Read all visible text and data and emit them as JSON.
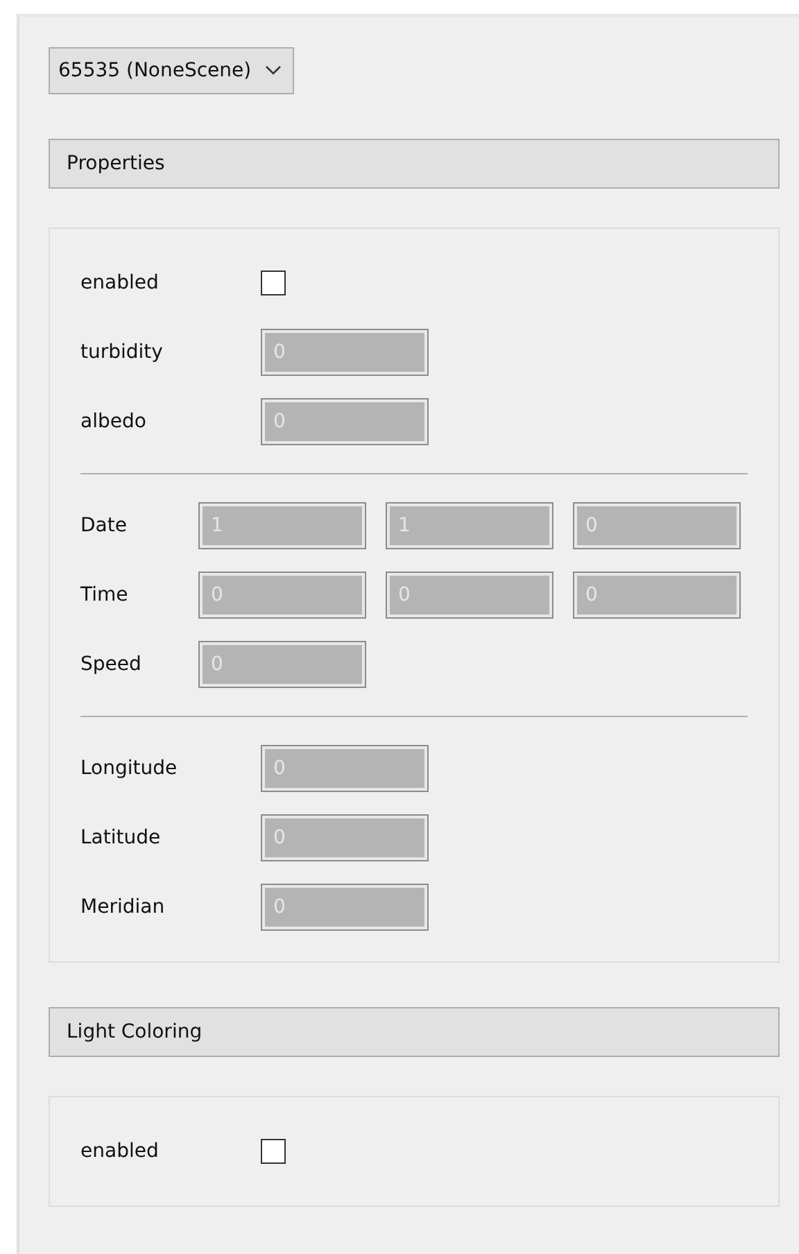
{
  "scene_dropdown": {
    "value": "65535 (NoneScene)"
  },
  "sections": [
    {
      "title": "Properties",
      "rows": [
        {
          "kind": "checkbox",
          "label": "enabled",
          "checked": false
        },
        {
          "kind": "field",
          "label": "turbidity",
          "values": [
            "0"
          ]
        },
        {
          "kind": "field",
          "label": "albedo",
          "values": [
            "0"
          ]
        },
        {
          "kind": "divider"
        },
        {
          "kind": "multi",
          "label": "Date",
          "values": [
            "1",
            "1",
            "0"
          ]
        },
        {
          "kind": "multi",
          "label": "Time",
          "values": [
            "0",
            "0",
            "0"
          ]
        },
        {
          "kind": "multi",
          "label": "Speed",
          "values": [
            "0"
          ]
        },
        {
          "kind": "divider"
        },
        {
          "kind": "field",
          "label": "Longitude",
          "values": [
            "0"
          ]
        },
        {
          "kind": "field",
          "label": "Latitude",
          "values": [
            "0"
          ]
        },
        {
          "kind": "field",
          "label": "Meridian",
          "values": [
            "0"
          ]
        }
      ]
    },
    {
      "title": "Light Coloring",
      "rows": [
        {
          "kind": "checkbox",
          "label": "enabled",
          "checked": false
        }
      ]
    }
  ]
}
